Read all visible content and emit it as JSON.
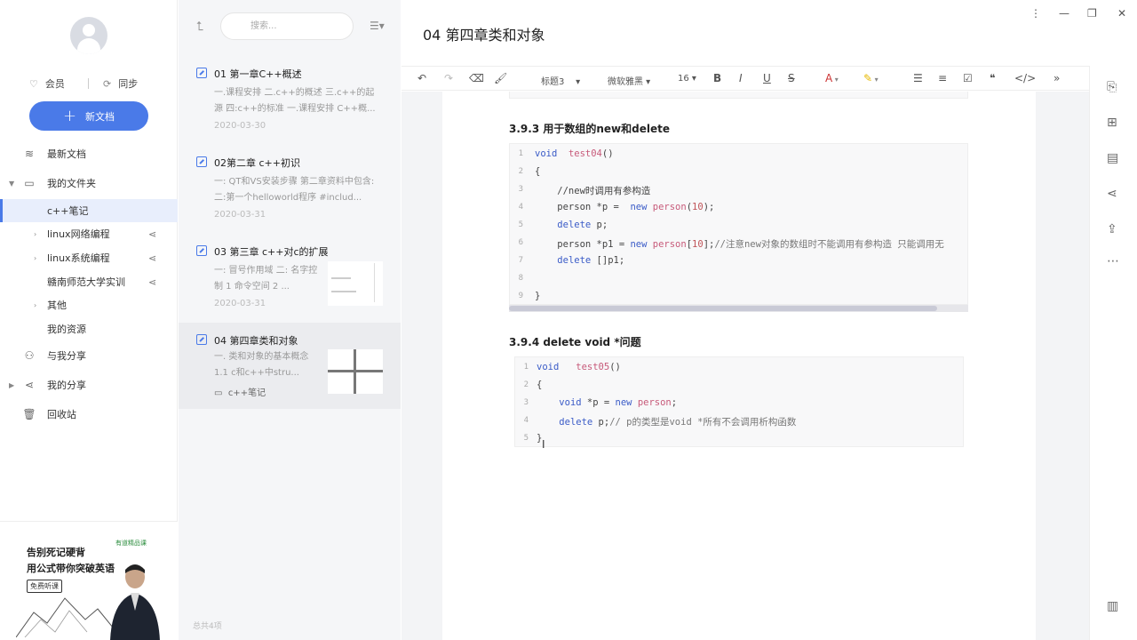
{
  "sidebar": {
    "member_label": "会员",
    "sync_label": "同步",
    "new_doc_label": "新文档",
    "nav": [
      {
        "label": "最新文档"
      },
      {
        "label": "我的文件夹"
      },
      {
        "label": "c++笔记"
      },
      {
        "label": "linux网络编程"
      },
      {
        "label": "linux系统编程"
      },
      {
        "label": "赣南师范大学实训"
      },
      {
        "label": "其他"
      },
      {
        "label": "我的资源"
      },
      {
        "label": "与我分享"
      },
      {
        "label": "我的分享"
      },
      {
        "label": "回收站"
      }
    ],
    "ad": {
      "line1": "告别死记硬背",
      "line2": "用公式带你突破英语",
      "button": "免费听课",
      "brand": "有道精品课"
    }
  },
  "notelist": {
    "search_placeholder": "搜索...",
    "count": "总共4项",
    "notes": [
      {
        "title": "01 第一章C++概述",
        "summary": "一.课程安排 二.c++的概述 三.c++的起源 四:c++的标准 一.课程安排 C++概...",
        "date": "2020-03-30"
      },
      {
        "title": "02第二章 c++初识",
        "summary": "一: QT和VS安装步骤 第二章资料中包含: 二:第一个helloworld程序 #includ...",
        "date": "2020-03-31"
      },
      {
        "title": "03 第三章 c++对c的扩展",
        "summary": "一: 冒号作用域 二: 名字控制 1 命令空间 2 ...",
        "date": "2020-03-31"
      },
      {
        "title": "04 第四章类和对象",
        "summary": "一. 类和对象的基本概念 1.1 c和c++中stru...",
        "folder": "c++笔记"
      }
    ]
  },
  "editor": {
    "title": "04 第四章类和对象",
    "toolbar": {
      "heading": "标题3",
      "font": "微软雅黑",
      "size": "16"
    },
    "sections": [
      {
        "heading": "3.9.3 用于数组的new和delete",
        "lines": [
          {
            "n": "1",
            "code": "void  test04()"
          },
          {
            "n": "2",
            "code": "{"
          },
          {
            "n": "3",
            "code": "    //new时调用有参构造"
          },
          {
            "n": "4",
            "code": "    person *p =  new person(10);"
          },
          {
            "n": "5",
            "code": "    delete p;"
          },
          {
            "n": "6",
            "code": "    person *p1 = new person[10];//注意new对象的数组时不能调用有参构造 只能调用无"
          },
          {
            "n": "7",
            "code": "    delete []p1;"
          },
          {
            "n": "8",
            "code": ""
          },
          {
            "n": "9",
            "code": "}"
          }
        ]
      },
      {
        "heading": "3.9.4 delete void *问题",
        "lines": [
          {
            "n": "1",
            "code": "void   test05()"
          },
          {
            "n": "2",
            "code": "{"
          },
          {
            "n": "3",
            "code": "    void *p = new person;"
          },
          {
            "n": "4",
            "code": "    delete p;// p的类型是void *所有不会调用析构函数"
          },
          {
            "n": "5",
            "code": "}"
          }
        ]
      }
    ]
  },
  "colors": {
    "accent": "#4a7ae8",
    "keyword": "#3a5bc7",
    "function": "#c75a7a"
  }
}
